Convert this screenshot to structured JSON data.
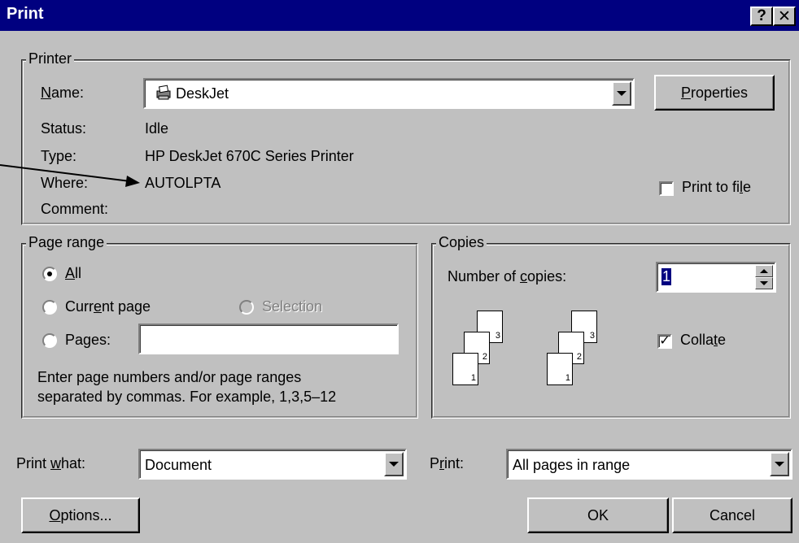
{
  "window": {
    "title": "Print",
    "help_btn": "?",
    "close_btn": "✕"
  },
  "printer": {
    "legend": "Printer",
    "name_label": "Name:",
    "name_value": "DeskJet",
    "properties_label": "Properties",
    "status_label": "Status:",
    "status_value": "Idle",
    "type_label": "Type:",
    "type_value": "HP DeskJet 670C Series Printer",
    "where_label": "Where:",
    "where_value": "AUTOLPTA",
    "comment_label": "Comment:",
    "comment_value": "",
    "print_to_file_label": "Print to file",
    "print_to_file_checked": false
  },
  "page_range": {
    "legend": "Page range",
    "all_label": "All",
    "current_page_label": "Current page",
    "selection_label": "Selection",
    "pages_label": "Pages:",
    "pages_value": "",
    "selected": "all",
    "help_text_line1": "Enter page numbers and/or page ranges",
    "help_text_line2": "separated by commas.  For example, 1,3,5–12"
  },
  "copies": {
    "legend": "Copies",
    "number_label": "Number of copies:",
    "number_value": "1",
    "collate_label": "Collate",
    "collate_checked": true,
    "collate_pages": [
      "1",
      "2",
      "3"
    ]
  },
  "bottom": {
    "print_what_label": "Print what:",
    "print_what_value": "Document",
    "print_label": "Print:",
    "print_value": "All pages in range",
    "options_label": "Options...",
    "ok_label": "OK",
    "cancel_label": "Cancel"
  },
  "colors": {
    "title_bar": "#000080",
    "face": "#c0c0c0",
    "highlight": "#000080"
  }
}
